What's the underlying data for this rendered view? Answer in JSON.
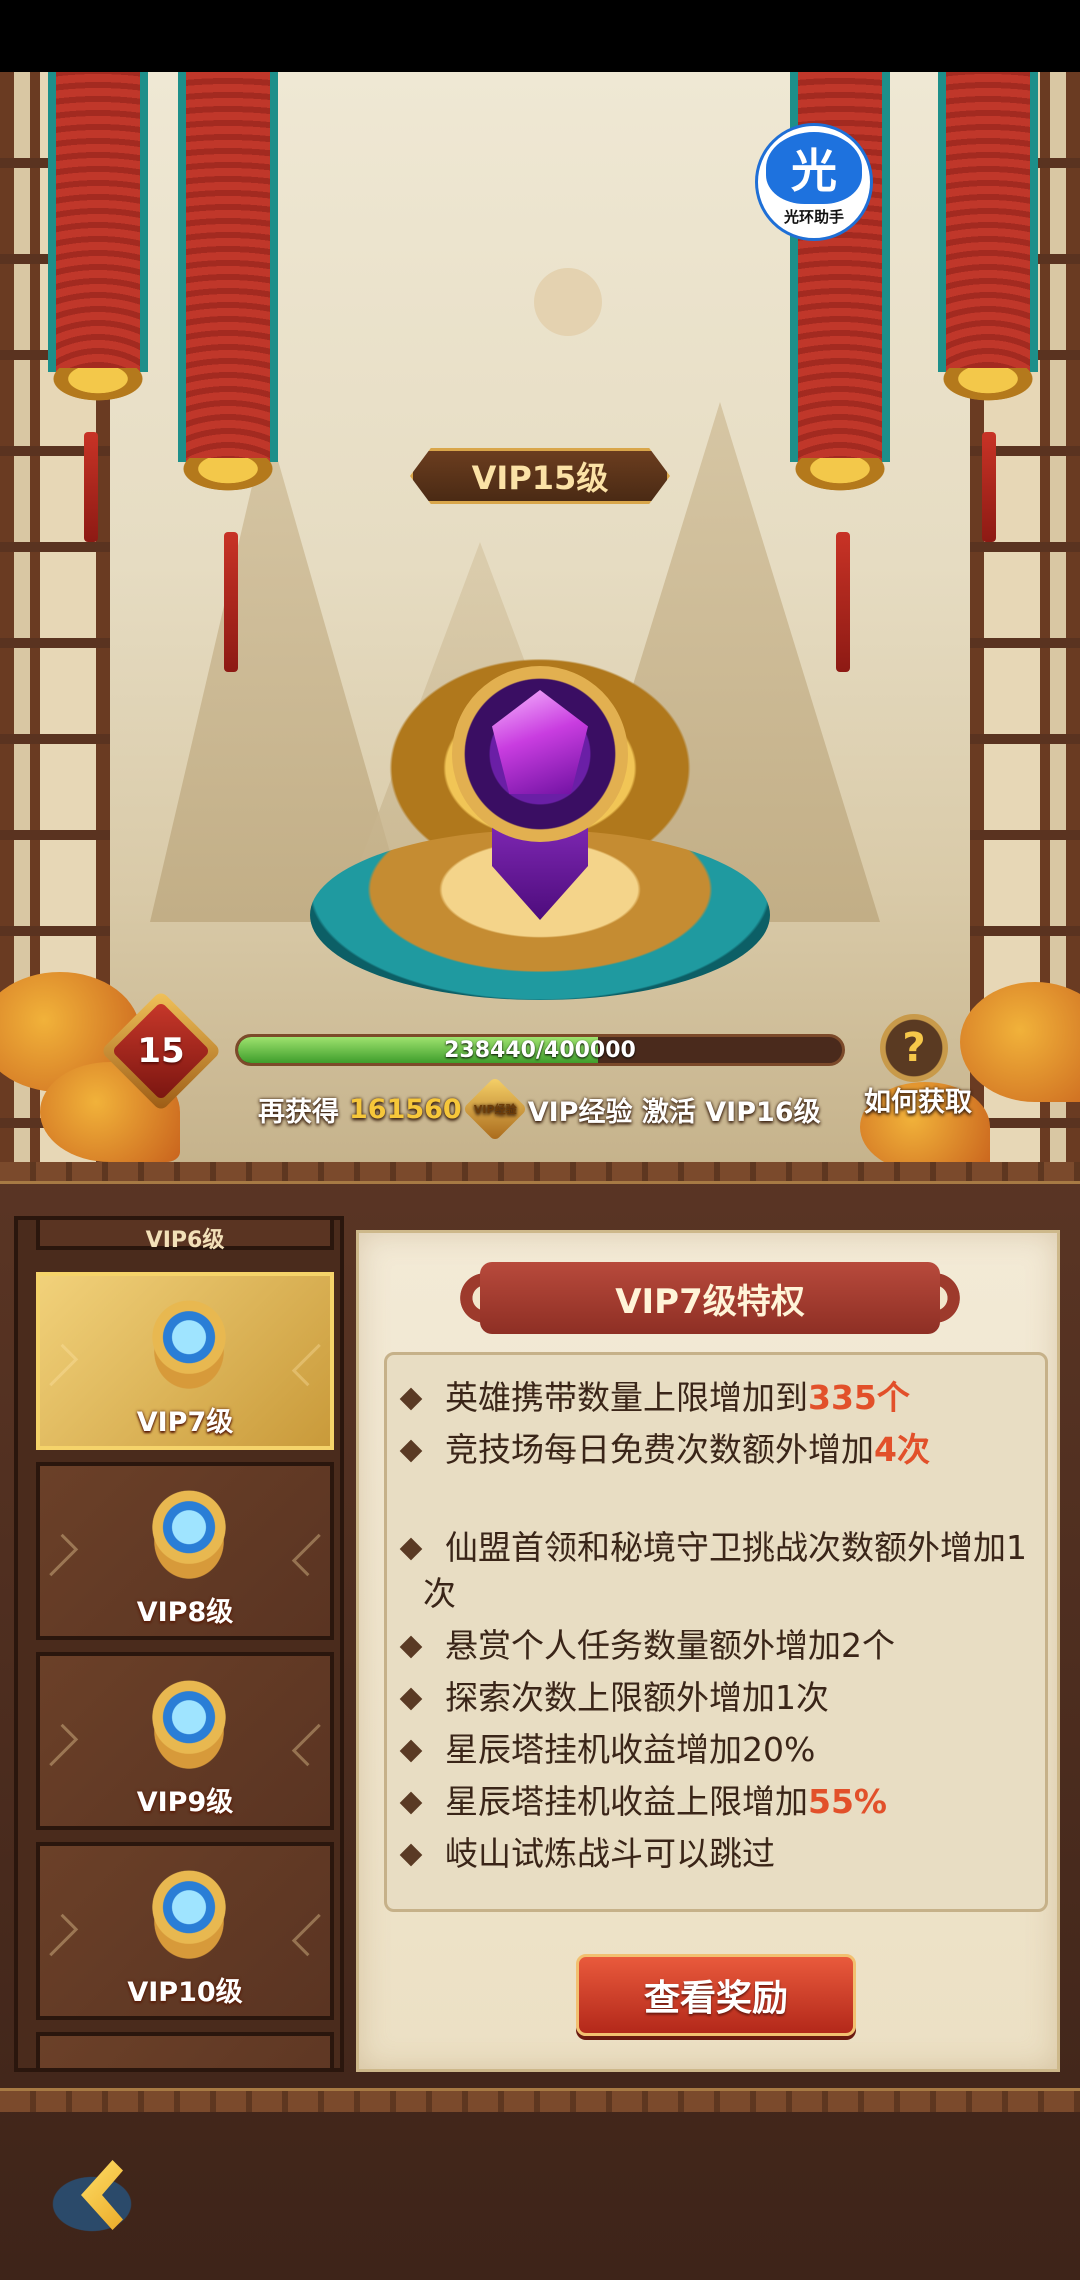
{
  "brand": {
    "glyph": "光",
    "name": "光环助手"
  },
  "header": {
    "vip_title": "VIP15级"
  },
  "progress": {
    "level": "15",
    "text": "238440/400000",
    "fraction": 0.596,
    "prefix": "再获得",
    "amount": "161560",
    "coin_label": "VIP经验",
    "suffix": "VIP经验 激活 VIP16级"
  },
  "help": {
    "icon_text": "?",
    "label": "如何获取"
  },
  "vip_list": {
    "partial_top": "VIP6级",
    "items": [
      {
        "label": "VIP7级",
        "active": true
      },
      {
        "label": "VIP8级",
        "active": false
      },
      {
        "label": "VIP9级",
        "active": false
      },
      {
        "label": "VIP10级",
        "active": false
      }
    ]
  },
  "detail": {
    "title": "VIP7级特权",
    "privileges": [
      {
        "text": "英雄携带数量上限增加到",
        "highlight": "335个"
      },
      {
        "text": "竞技场每日免费次数额外增加",
        "highlight": "4次"
      },
      {
        "text": "仙盟首领和秘境守卫挑战次数额外增加1次",
        "highlight": ""
      },
      {
        "text": "悬赏个人任务数量额外增加2个",
        "highlight": ""
      },
      {
        "text": "探索次数上限额外增加1次",
        "highlight": ""
      },
      {
        "text": "星辰塔挂机收益增加20%",
        "highlight": ""
      },
      {
        "text": "星辰塔挂机收益上限增加",
        "highlight": "55%"
      },
      {
        "text": "岐山试炼战斗可以跳过",
        "highlight": ""
      }
    ],
    "reward_button": "查看奖励"
  },
  "colors": {
    "highlight": "#e2502a",
    "exp_fill": "#3f9e2c",
    "gold": "#f6c73a"
  },
  "icons": {
    "back": "back-arrow-icon",
    "help": "question-icon",
    "brand": "guanghuan-icon"
  }
}
